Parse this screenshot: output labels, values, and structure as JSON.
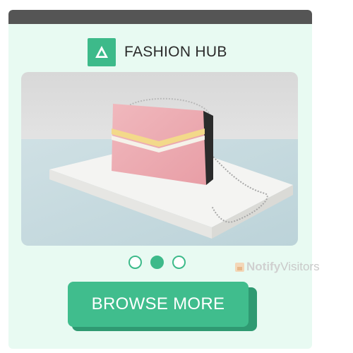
{
  "brand": {
    "name": "FASHION HUB",
    "logo_icon": "triangle-logo-icon",
    "accent_color": "#3dba8a"
  },
  "hero": {
    "image": "pink-crossbody-handbag-photo"
  },
  "carousel": {
    "slide_count": 3,
    "active_index": 1
  },
  "cta": {
    "label": "BROWSE MORE"
  },
  "watermark": {
    "part1": "Notify",
    "part2": "Visitors"
  }
}
